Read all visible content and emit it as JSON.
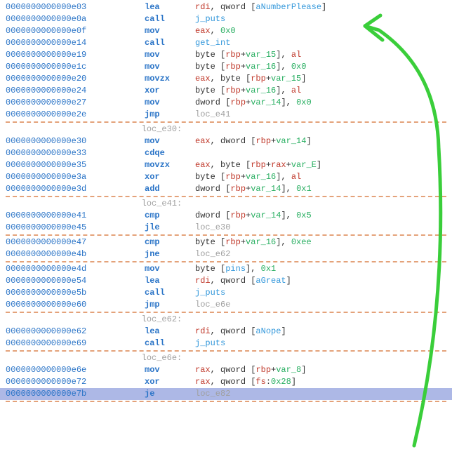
{
  "blocks": [
    {
      "type": "line",
      "addr": "0000000000000e03",
      "mnem": "lea",
      "ops": [
        {
          "t": "reg",
          "v": "rdi"
        },
        {
          "t": "p",
          "v": ", qword ["
        },
        {
          "t": "sym",
          "v": "aNumberPlease"
        },
        {
          "t": "p",
          "v": "]"
        }
      ]
    },
    {
      "type": "line",
      "addr": "0000000000000e0a",
      "mnem": "call",
      "ops": [
        {
          "t": "sym",
          "v": "j_puts"
        }
      ]
    },
    {
      "type": "line",
      "addr": "0000000000000e0f",
      "mnem": "mov",
      "ops": [
        {
          "t": "reg",
          "v": "eax"
        },
        {
          "t": "p",
          "v": ", "
        },
        {
          "t": "imm",
          "v": "0x0"
        }
      ]
    },
    {
      "type": "line",
      "addr": "0000000000000e14",
      "mnem": "call",
      "ops": [
        {
          "t": "sym",
          "v": "get_int"
        }
      ]
    },
    {
      "type": "line",
      "addr": "0000000000000e19",
      "mnem": "mov",
      "ops": [
        {
          "t": "p",
          "v": "byte ["
        },
        {
          "t": "reg",
          "v": "rbp"
        },
        {
          "t": "p",
          "v": "+"
        },
        {
          "t": "varv",
          "v": "var_15"
        },
        {
          "t": "p",
          "v": "], "
        },
        {
          "t": "reg",
          "v": "al"
        }
      ]
    },
    {
      "type": "line",
      "addr": "0000000000000e1c",
      "mnem": "mov",
      "ops": [
        {
          "t": "p",
          "v": "byte ["
        },
        {
          "t": "reg",
          "v": "rbp"
        },
        {
          "t": "p",
          "v": "+"
        },
        {
          "t": "varv",
          "v": "var_16"
        },
        {
          "t": "p",
          "v": "], "
        },
        {
          "t": "imm",
          "v": "0x0"
        }
      ]
    },
    {
      "type": "line",
      "addr": "0000000000000e20",
      "mnem": "movzx",
      "ops": [
        {
          "t": "reg",
          "v": "eax"
        },
        {
          "t": "p",
          "v": ", byte ["
        },
        {
          "t": "reg",
          "v": "rbp"
        },
        {
          "t": "p",
          "v": "+"
        },
        {
          "t": "varv",
          "v": "var_15"
        },
        {
          "t": "p",
          "v": "]"
        }
      ]
    },
    {
      "type": "line",
      "addr": "0000000000000e24",
      "mnem": "xor",
      "ops": [
        {
          "t": "p",
          "v": "byte ["
        },
        {
          "t": "reg",
          "v": "rbp"
        },
        {
          "t": "p",
          "v": "+"
        },
        {
          "t": "varv",
          "v": "var_16"
        },
        {
          "t": "p",
          "v": "], "
        },
        {
          "t": "reg",
          "v": "al"
        }
      ]
    },
    {
      "type": "line",
      "addr": "0000000000000e27",
      "mnem": "mov",
      "ops": [
        {
          "t": "p",
          "v": "dword ["
        },
        {
          "t": "reg",
          "v": "rbp"
        },
        {
          "t": "p",
          "v": "+"
        },
        {
          "t": "varv",
          "v": "var_14"
        },
        {
          "t": "p",
          "v": "], "
        },
        {
          "t": "imm",
          "v": "0x0"
        }
      ]
    },
    {
      "type": "line",
      "addr": "0000000000000e2e",
      "mnem": "jmp",
      "ops": [
        {
          "t": "locref",
          "v": "loc_e41"
        }
      ]
    },
    {
      "type": "sep"
    },
    {
      "type": "label",
      "label": "loc_e30"
    },
    {
      "type": "line",
      "addr": "0000000000000e30",
      "mnem": "mov",
      "ops": [
        {
          "t": "reg",
          "v": "eax"
        },
        {
          "t": "p",
          "v": ", dword ["
        },
        {
          "t": "reg",
          "v": "rbp"
        },
        {
          "t": "p",
          "v": "+"
        },
        {
          "t": "varv",
          "v": "var_14"
        },
        {
          "t": "p",
          "v": "]"
        }
      ]
    },
    {
      "type": "line",
      "addr": "0000000000000e33",
      "mnem": "cdqe",
      "ops": []
    },
    {
      "type": "line",
      "addr": "0000000000000e35",
      "mnem": "movzx",
      "ops": [
        {
          "t": "reg",
          "v": "eax"
        },
        {
          "t": "p",
          "v": ", byte ["
        },
        {
          "t": "reg",
          "v": "rbp"
        },
        {
          "t": "p",
          "v": "+"
        },
        {
          "t": "reg",
          "v": "rax"
        },
        {
          "t": "p",
          "v": "+"
        },
        {
          "t": "varv",
          "v": "var_E"
        },
        {
          "t": "p",
          "v": "]"
        }
      ]
    },
    {
      "type": "line",
      "addr": "0000000000000e3a",
      "mnem": "xor",
      "ops": [
        {
          "t": "p",
          "v": "byte ["
        },
        {
          "t": "reg",
          "v": "rbp"
        },
        {
          "t": "p",
          "v": "+"
        },
        {
          "t": "varv",
          "v": "var_16"
        },
        {
          "t": "p",
          "v": "], "
        },
        {
          "t": "reg",
          "v": "al"
        }
      ]
    },
    {
      "type": "line",
      "addr": "0000000000000e3d",
      "mnem": "add",
      "ops": [
        {
          "t": "p",
          "v": "dword ["
        },
        {
          "t": "reg",
          "v": "rbp"
        },
        {
          "t": "p",
          "v": "+"
        },
        {
          "t": "varv",
          "v": "var_14"
        },
        {
          "t": "p",
          "v": "], "
        },
        {
          "t": "imm",
          "v": "0x1"
        }
      ]
    },
    {
      "type": "sep"
    },
    {
      "type": "label",
      "label": "loc_e41"
    },
    {
      "type": "line",
      "addr": "0000000000000e41",
      "mnem": "cmp",
      "ops": [
        {
          "t": "p",
          "v": "dword ["
        },
        {
          "t": "reg",
          "v": "rbp"
        },
        {
          "t": "p",
          "v": "+"
        },
        {
          "t": "varv",
          "v": "var_14"
        },
        {
          "t": "p",
          "v": "], "
        },
        {
          "t": "imm",
          "v": "0x5"
        }
      ]
    },
    {
      "type": "line",
      "addr": "0000000000000e45",
      "mnem": "jle",
      "ops": [
        {
          "t": "locref",
          "v": "loc_e30"
        }
      ]
    },
    {
      "type": "sep"
    },
    {
      "type": "line",
      "addr": "0000000000000e47",
      "mnem": "cmp",
      "ops": [
        {
          "t": "p",
          "v": "byte ["
        },
        {
          "t": "reg",
          "v": "rbp"
        },
        {
          "t": "p",
          "v": "+"
        },
        {
          "t": "varv",
          "v": "var_16"
        },
        {
          "t": "p",
          "v": "], "
        },
        {
          "t": "imm",
          "v": "0xee"
        }
      ]
    },
    {
      "type": "line",
      "addr": "0000000000000e4b",
      "mnem": "jne",
      "ops": [
        {
          "t": "locref",
          "v": "loc_e62"
        }
      ]
    },
    {
      "type": "sep"
    },
    {
      "type": "line",
      "addr": "0000000000000e4d",
      "mnem": "mov",
      "ops": [
        {
          "t": "p",
          "v": "byte ["
        },
        {
          "t": "sym",
          "v": "pins"
        },
        {
          "t": "p",
          "v": "], "
        },
        {
          "t": "imm",
          "v": "0x1"
        }
      ]
    },
    {
      "type": "line",
      "addr": "0000000000000e54",
      "mnem": "lea",
      "ops": [
        {
          "t": "reg",
          "v": "rdi"
        },
        {
          "t": "p",
          "v": ", qword ["
        },
        {
          "t": "sym",
          "v": "aGreat"
        },
        {
          "t": "p",
          "v": "]"
        }
      ]
    },
    {
      "type": "line",
      "addr": "0000000000000e5b",
      "mnem": "call",
      "ops": [
        {
          "t": "sym",
          "v": "j_puts"
        }
      ]
    },
    {
      "type": "line",
      "addr": "0000000000000e60",
      "mnem": "jmp",
      "ops": [
        {
          "t": "locref",
          "v": "loc_e6e"
        }
      ]
    },
    {
      "type": "sep"
    },
    {
      "type": "label",
      "label": "loc_e62"
    },
    {
      "type": "line",
      "addr": "0000000000000e62",
      "mnem": "lea",
      "ops": [
        {
          "t": "reg",
          "v": "rdi"
        },
        {
          "t": "p",
          "v": ", qword ["
        },
        {
          "t": "sym",
          "v": "aNope"
        },
        {
          "t": "p",
          "v": "]"
        }
      ]
    },
    {
      "type": "line",
      "addr": "0000000000000e69",
      "mnem": "call",
      "ops": [
        {
          "t": "sym",
          "v": "j_puts"
        }
      ]
    },
    {
      "type": "sep"
    },
    {
      "type": "label",
      "label": "loc_e6e"
    },
    {
      "type": "line",
      "addr": "0000000000000e6e",
      "mnem": "mov",
      "ops": [
        {
          "t": "reg",
          "v": "rax"
        },
        {
          "t": "p",
          "v": ", qword ["
        },
        {
          "t": "reg",
          "v": "rbp"
        },
        {
          "t": "p",
          "v": "+"
        },
        {
          "t": "varv",
          "v": "var_8"
        },
        {
          "t": "p",
          "v": "]"
        }
      ]
    },
    {
      "type": "line",
      "addr": "0000000000000e72",
      "mnem": "xor",
      "ops": [
        {
          "t": "reg",
          "v": "rax"
        },
        {
          "t": "p",
          "v": ", qword ["
        },
        {
          "t": "reg",
          "v": "fs"
        },
        {
          "t": "p",
          "v": ":"
        },
        {
          "t": "imm",
          "v": "0x28"
        },
        {
          "t": "p",
          "v": "]"
        }
      ]
    },
    {
      "type": "line",
      "addr": "0000000000000e7b",
      "mnem": "je",
      "ops": [
        {
          "t": "locref",
          "v": "loc_e82"
        }
      ],
      "hl": true
    },
    {
      "type": "sep"
    }
  ]
}
